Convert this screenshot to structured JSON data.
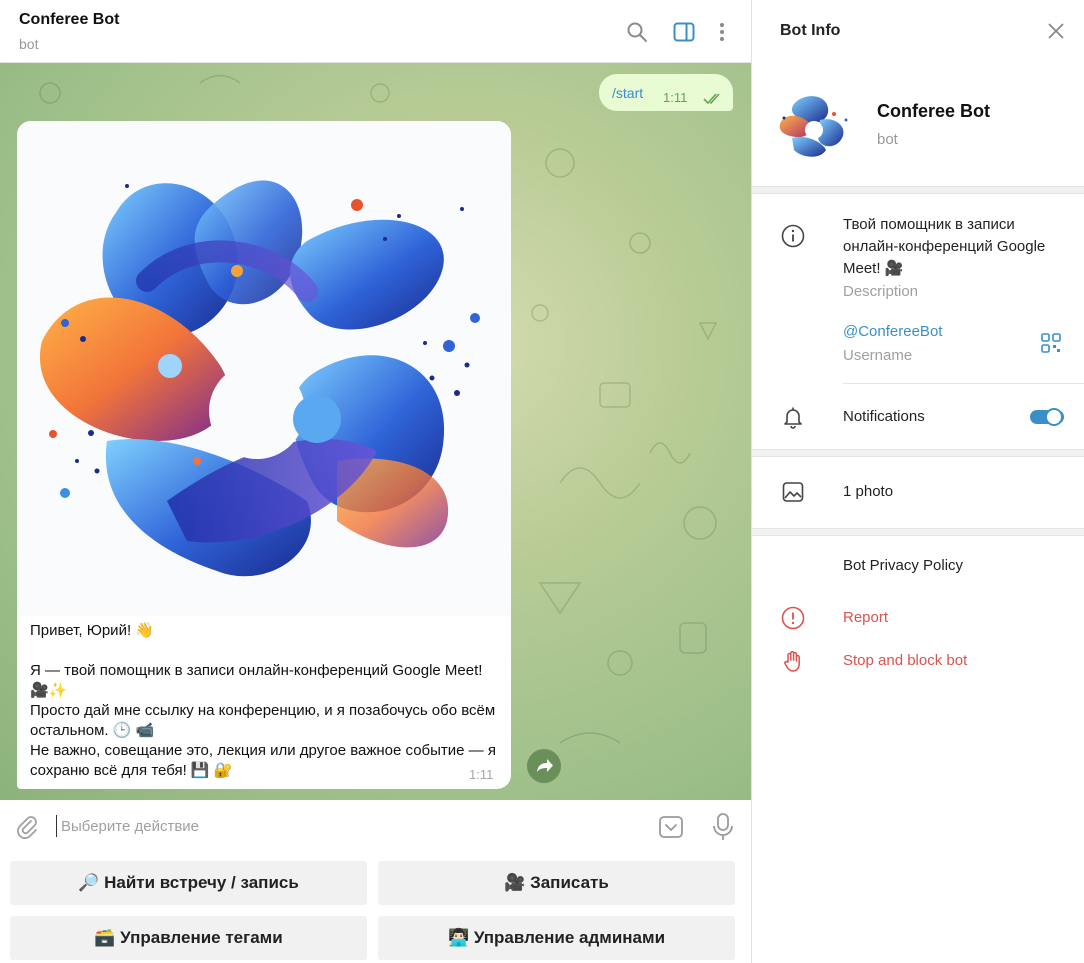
{
  "chat": {
    "title": "Conferee Bot",
    "subtitle": "bot",
    "outgoing": {
      "text": "/start",
      "time": "1:11"
    },
    "incoming": {
      "text": "Привет, Юрий! 👋\n\nЯ — твой помощник в записи онлайн-конференций Google Meet! 🎥✨\nПросто дай мне ссылку на конференцию, и я позабочусь обо всём остальном. 🕒 📹\nНе важно, совещание это, лекция или другое важное событие — я сохраню всё для тебя! 💾 🔐",
      "time": "1:11"
    }
  },
  "input": {
    "placeholder": "Выберите действие"
  },
  "keyboard": {
    "find": "🔎 Найти встречу / запись",
    "record": "🎥 Записать",
    "tags": "🗃️ Управление тегами",
    "admins": "👨🏻‍💻 Управление админами"
  },
  "info_panel": {
    "title": "Bot Info",
    "name": "Conferee Bot",
    "sub": "bot",
    "description": "Твой помощник в записи онлайн-конференций Google Meet! 🎥",
    "description_label": "Description",
    "username": "@ConfereeBot",
    "username_label": "Username",
    "notifications_label": "Notifications",
    "notifications_on": true,
    "photos_label": "1 photo",
    "privacy_label": "Bot Privacy Policy",
    "report_label": "Report",
    "stop_label": "Stop and block bot"
  },
  "colors": {
    "accent": "#3b8fc7",
    "danger": "#d9534f",
    "outgoing_bubble": "#e8fbd3",
    "chat_background": "#b8cb95"
  },
  "icons": [
    "search-icon",
    "sidebar-toggle-icon",
    "more-icon",
    "double-check-icon",
    "forward-icon",
    "attach-icon",
    "keyboard-icon",
    "mic-icon",
    "close-icon",
    "info-icon",
    "qr-code-icon",
    "bell-icon",
    "photo-icon",
    "report-icon",
    "stop-hand-icon"
  ]
}
